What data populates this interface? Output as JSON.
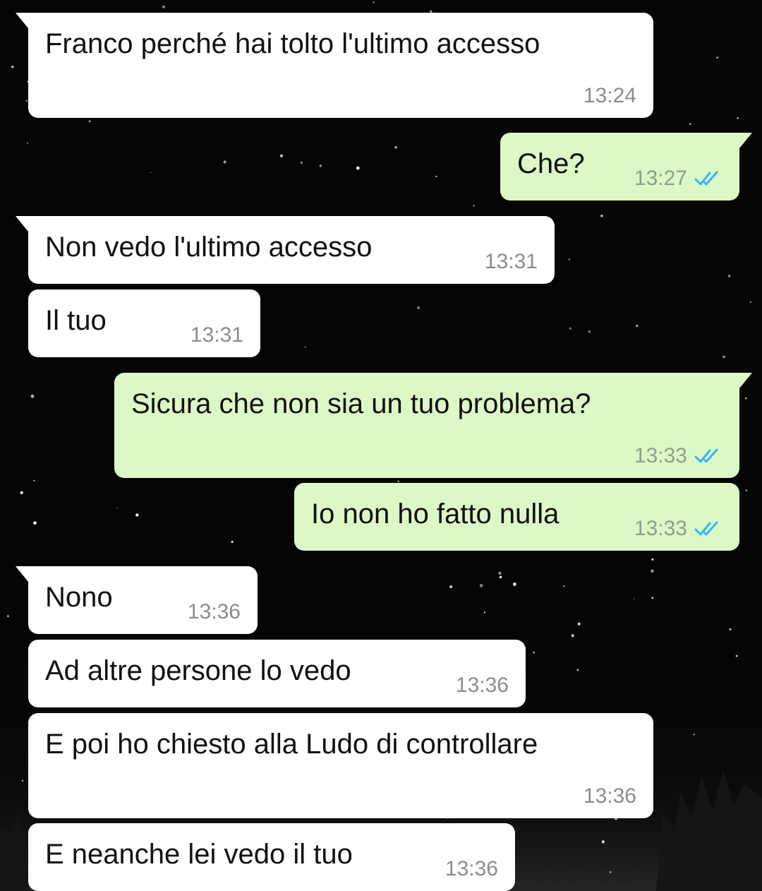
{
  "colors": {
    "incoming_bubble": "#ffffff",
    "outgoing_bubble": "#dcf8c6",
    "read_ticks": "#34b7f1",
    "background": "#050505"
  },
  "messages": [
    {
      "direction": "incoming",
      "text": "Franco perché hai tolto l'ultimo accesso",
      "time": "13:24"
    },
    {
      "direction": "outgoing",
      "text": "Che?",
      "time": "13:27",
      "status": "read-double-check-icon"
    },
    {
      "direction": "incoming",
      "text": "Non vedo l'ultimo accesso",
      "time": "13:31"
    },
    {
      "direction": "incoming",
      "text": "Il tuo",
      "time": "13:31"
    },
    {
      "direction": "outgoing",
      "text": "Sicura che non sia un tuo problema?",
      "time": "13:33",
      "status": "read-double-check-icon"
    },
    {
      "direction": "outgoing",
      "text": "Io non ho fatto nulla",
      "time": "13:33",
      "status": "read-double-check-icon"
    },
    {
      "direction": "incoming",
      "text": "Nono",
      "time": "13:36"
    },
    {
      "direction": "incoming",
      "text": "Ad altre persone lo vedo",
      "time": "13:36"
    },
    {
      "direction": "incoming",
      "text": "E poi ho chiesto alla Ludo di controllare",
      "time": "13:36"
    },
    {
      "direction": "incoming",
      "text": "E neanche lei vedo il tuo",
      "time": "13:36"
    }
  ]
}
